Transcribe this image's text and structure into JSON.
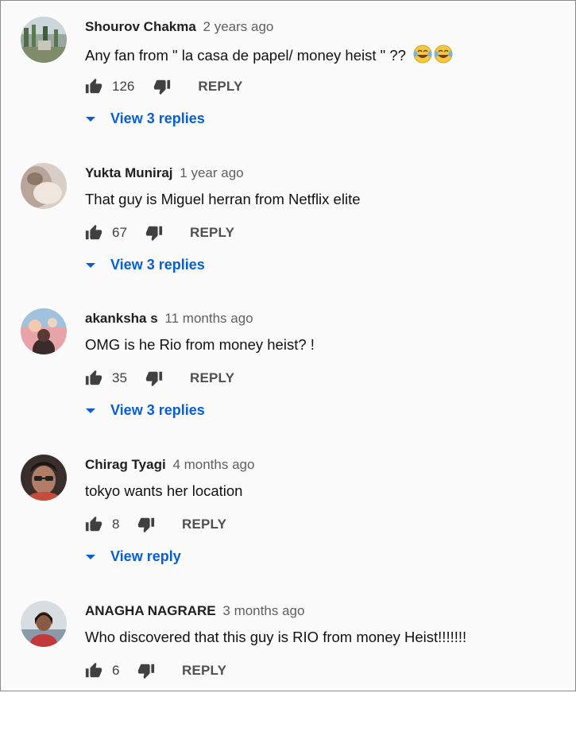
{
  "colors": {
    "link": "#065fd4",
    "icon": "#404040"
  },
  "comments": [
    {
      "author": "Shourov Chakma",
      "time": "2 years ago",
      "text": "Any fan from \" la casa de papel/ money heist \" ??",
      "emoji": "face-with-tears-of-joy x2",
      "likes": "126",
      "reply_label": "REPLY",
      "view_replies": "View 3 replies"
    },
    {
      "author": "Yukta Muniraj",
      "time": "1 year ago",
      "text": "That guy is Miguel herran from Netflix elite",
      "likes": "67",
      "reply_label": "REPLY",
      "view_replies": "View 3 replies"
    },
    {
      "author": "akanksha s",
      "time": "11 months ago",
      "text": "OMG is he Rio from money heist? !",
      "likes": "35",
      "reply_label": "REPLY",
      "view_replies": "View 3 replies"
    },
    {
      "author": "Chirag Tyagi",
      "time": "4 months ago",
      "text": "tokyo wants her location",
      "likes": "8",
      "reply_label": "REPLY",
      "view_replies": "View reply"
    },
    {
      "author": "ANAGHA NAGRARE",
      "time": "3 months ago",
      "text": "Who discovered that this guy is RIO from money Heist!!!!!!!",
      "likes": "6",
      "reply_label": "REPLY"
    }
  ],
  "icons": [
    "like-icon",
    "dislike-icon",
    "caret-down-icon",
    "avatar"
  ]
}
